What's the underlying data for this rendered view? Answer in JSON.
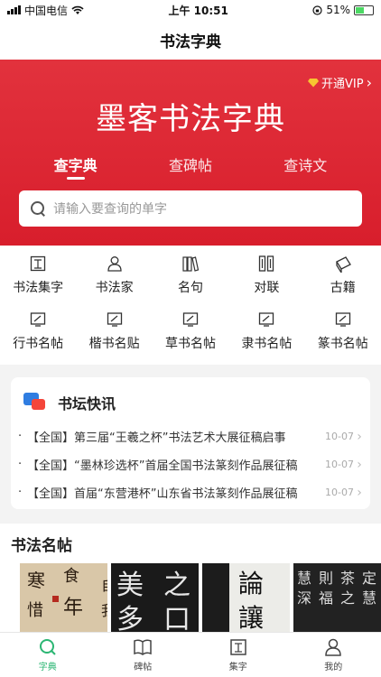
{
  "status_bar": {
    "carrier": "中国电信",
    "time": "上午 10:51",
    "battery": "51%",
    "battery_level": 0.51
  },
  "nav": {
    "title": "书法字典"
  },
  "hero": {
    "vip_label": "开通VIP",
    "title": "墨客书法字典",
    "tabs": [
      {
        "label": "查字典",
        "active": true
      },
      {
        "label": "查碑帖",
        "active": false
      },
      {
        "label": "查诗文",
        "active": false
      }
    ],
    "search_placeholder": "请输入要查询的单字"
  },
  "categories": [
    {
      "label": "书法集字",
      "icon": "text-doc-icon"
    },
    {
      "label": "书法家",
      "icon": "person-icon"
    },
    {
      "label": "名句",
      "icon": "books-icon"
    },
    {
      "label": "对联",
      "icon": "couplet-icon"
    },
    {
      "label": "古籍",
      "icon": "scroll-icon"
    },
    {
      "label": "行书名帖",
      "icon": "frame-icon"
    },
    {
      "label": "楷书名贴",
      "icon": "frame-icon"
    },
    {
      "label": "草书名帖",
      "icon": "frame-icon"
    },
    {
      "label": "隶书名帖",
      "icon": "frame-icon"
    },
    {
      "label": "篆书名帖",
      "icon": "frame-icon"
    }
  ],
  "news": {
    "title": "书坛快讯",
    "items": [
      {
        "text": "【全国】第三届“王羲之杯”书法艺术大展征稿启事",
        "date": "10-07"
      },
      {
        "text": "【全国】“墨林珍选杯”首届全国书法篆刻作品展征稿",
        "date": "10-07"
      },
      {
        "text": "【全国】首届“东营港杯”山东省书法篆刻作品展征稿",
        "date": "10-07"
      }
    ]
  },
  "masterpieces": {
    "title": "书法名帖",
    "thumbs": [
      {
        "chars": "寒食帖"
      },
      {
        "chars": "美之多口"
      },
      {
        "chars": "論讓"
      },
      {
        "chars": "定慧則茶福"
      }
    ]
  },
  "tabbar": [
    {
      "label": "字典",
      "active": true
    },
    {
      "label": "碑帖",
      "active": false
    },
    {
      "label": "集字",
      "active": false
    },
    {
      "label": "我的",
      "active": false
    }
  ],
  "colors": {
    "brand_red": "#dd2430",
    "active_green": "#2bb673"
  }
}
